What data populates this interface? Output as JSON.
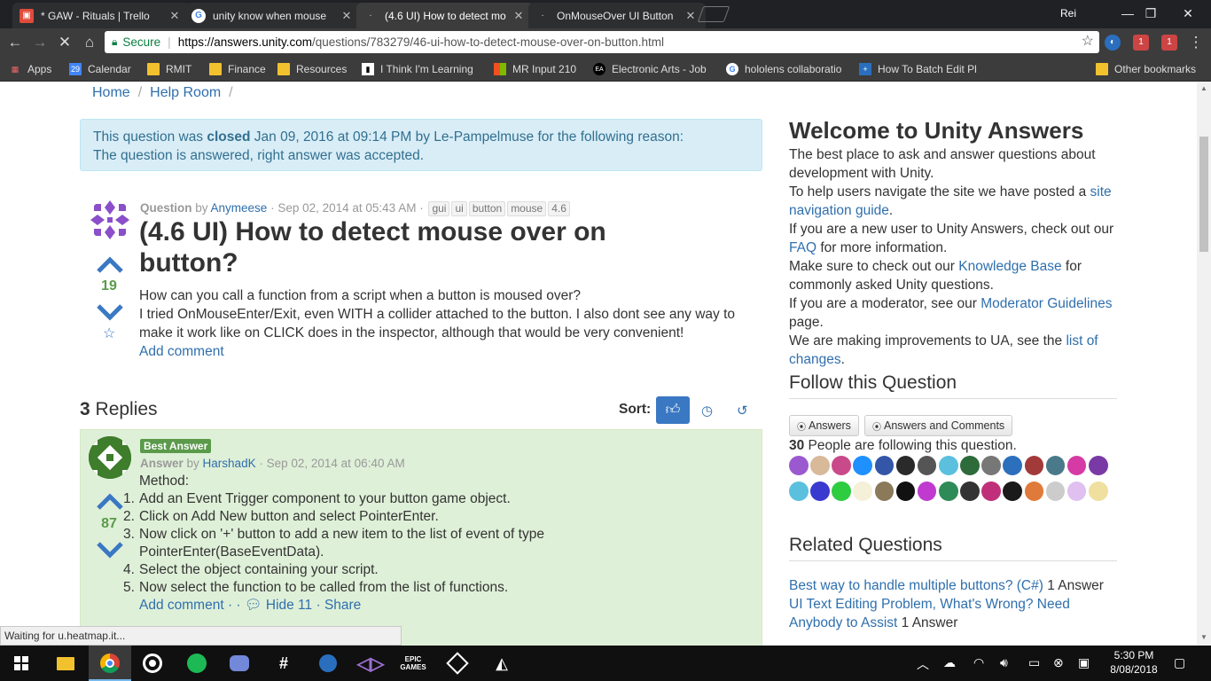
{
  "browser": {
    "tabs": [
      {
        "title": "* GAW - Rituals | Trello",
        "active": false
      },
      {
        "title": "unity know when mouse",
        "active": false
      },
      {
        "title": "(4.6 UI) How to detect mo",
        "active": true
      },
      {
        "title": "OnMouseOver UI Button",
        "active": false
      }
    ],
    "profile": "Rei",
    "secure_label": "Secure",
    "url_host": "https://answers.unity.com",
    "url_path": "/questions/783279/46-ui-how-to-detect-mouse-over-on-button.html",
    "ext_badge_1": "1",
    "ext_badge_2": "1",
    "bookmarks": [
      {
        "label": "Apps"
      },
      {
        "label": "Calendar",
        "icon_text": "29"
      },
      {
        "label": "RMIT"
      },
      {
        "label": "Finance"
      },
      {
        "label": "Resources"
      },
      {
        "label": "I Think I'm Learning"
      },
      {
        "label": "MR Input 210"
      },
      {
        "label": "Electronic Arts - Job"
      },
      {
        "label": "hololens collaboratio"
      },
      {
        "label": "How To Batch Edit Pl"
      },
      {
        "label": "Other bookmarks"
      }
    ]
  },
  "page": {
    "breadcrumb": [
      "Home",
      "Help Room"
    ],
    "notice": {
      "pre": "This question was ",
      "closed": "closed",
      "post": " Jan 09, 2016 at 09:14 PM by Le-Pampelmuse for the following reason:",
      "reason": "The question is answered, right answer was accepted."
    },
    "question": {
      "type_label": "Question",
      "by": " by ",
      "author": "Anymeese",
      "date": " · Sep 02, 2014 at 05:43 AM · ",
      "tags": [
        "gui",
        "ui",
        "button",
        "mouse",
        "4.6"
      ],
      "title": "(4.6 UI) How to detect mouse over on button?",
      "votes": "19",
      "body_1": "How can you call a function from a script when a button is moused over?",
      "body_2": "I tried OnMouseEnter/Exit, even WITH a collider attached to the button. I also dont see any way to make it work like on CLICK does in the inspector, although that would be very convenient!",
      "add_comment": "Add comment"
    },
    "replies": {
      "count": "3",
      "label": " Replies",
      "sort_label": "Sort:"
    },
    "answer": {
      "badge": "Best Answer",
      "type_label": "Answer",
      "by": " by ",
      "author": "HarshadK",
      "date": " · Sep 02, 2014 at 06:40 AM",
      "votes": "87",
      "intro": "Method:",
      "steps": [
        {
          "num": "1.",
          "text": "Add an Event Trigger component to your button game object."
        },
        {
          "num": "2.",
          "text": "Click on Add New button and select PointerEnter."
        },
        {
          "num": "3.",
          "text": "Now click on '+' button to add a new item to the list of event of type PointerEnter(BaseEventData)."
        },
        {
          "num": "4.",
          "text": "Select the object containing your script."
        },
        {
          "num": "5.",
          "text": "Now select the function to be called from the list of functions."
        }
      ],
      "add_comment": "Add comment",
      "dot1": " · ",
      "dot2": " · ",
      "hide": "Hide 11",
      "dot3": " · ",
      "share": "Share"
    },
    "sidebar": {
      "welcome_title": "Welcome to Unity Answers",
      "p1": "The best place to ask and answer questions about development with Unity.",
      "p2_pre": "To help users navigate the site we have posted a ",
      "p2_link": "site navigation guide",
      "p2_post": ".",
      "p3_pre": "If you are a new user to Unity Answers, check out our ",
      "p3_link": "FAQ",
      "p3_post": " for more information.",
      "p4_pre": "Make sure to check out our ",
      "p4_link": "Knowledge Base",
      "p4_post": " for commonly asked Unity questions.",
      "p5_pre": "If you are a moderator, see our ",
      "p5_link": "Moderator Guidelines",
      "p5_post": " page.",
      "p6_pre": "We are making improvements to UA, see the ",
      "p6_link": "list of changes",
      "p6_post": ".",
      "follow_title": "Follow this Question",
      "btn_answers": "Answers",
      "btn_answers_comments": "Answers and Comments",
      "followers_count": "30",
      "followers_text": " People are following this question.",
      "related_title": "Related Questions",
      "related": [
        {
          "link": "Best way to handle multiple buttons? (C#)",
          "count": " 1 Answer"
        },
        {
          "link": "UI Text Editing Problem, What's Wrong? Need Anybody to Assist",
          "count": " 1 Answer"
        }
      ]
    },
    "status": "Waiting for u.heatmap.it..."
  },
  "taskbar": {
    "time": "5:30 PM",
    "date": "8/08/2018"
  }
}
